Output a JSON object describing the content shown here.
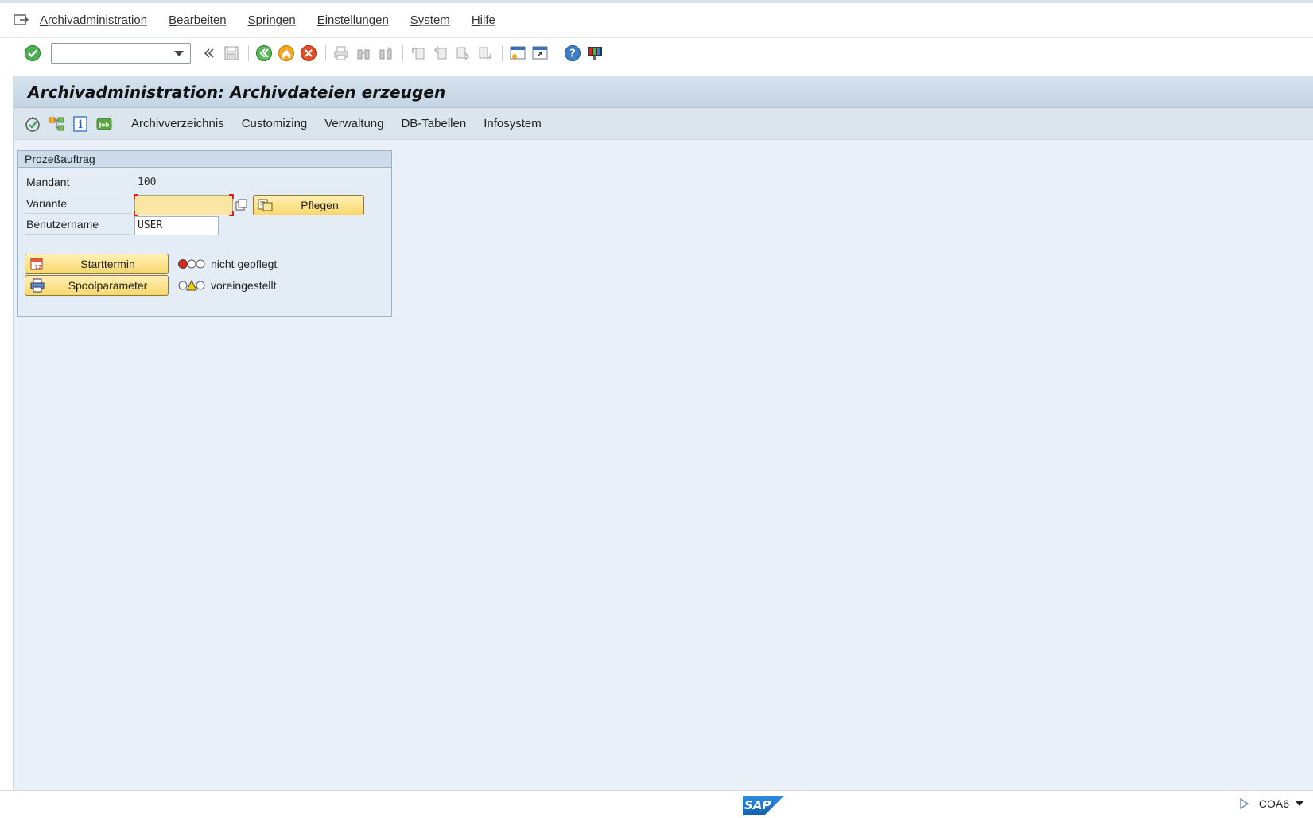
{
  "menubar": {
    "items": [
      "Archivadministration",
      "Bearbeiten",
      "Springen",
      "Einstellungen",
      "System",
      "Hilfe"
    ]
  },
  "toolbar": {
    "command_value": "",
    "icons": [
      "enter-icon",
      "back-double-icon",
      "save-icon",
      "back-icon",
      "exit-icon",
      "cancel-icon",
      "print-icon",
      "find-icon",
      "find-next-icon",
      "first-page-icon",
      "prev-page-icon",
      "next-page-icon",
      "last-page-icon",
      "new-session-icon",
      "shortcut-icon",
      "help-icon",
      "customize-layout-icon"
    ]
  },
  "title": "Archivadministration: Archivdateien erzeugen",
  "app_toolbar": {
    "links": [
      "Archivverzeichnis",
      "Customizing",
      "Verwaltung",
      "DB-Tabellen",
      "Infosystem"
    ]
  },
  "group": {
    "title": "Prozeßauftrag",
    "mandant_label": "Mandant",
    "mandant_value": "100",
    "variante_label": "Variante",
    "variante_value": "",
    "benutzer_label": "Benutzername",
    "benutzer_value": "USER",
    "pflegen_label": "Pflegen",
    "starttermin_label": "Starttermin",
    "starttermin_status": "nicht gepflegt",
    "spool_label": "Spoolparameter",
    "spool_status": "voreingestellt"
  },
  "statusbar": {
    "logo": "SAP",
    "transaction": "COA6"
  },
  "colors": {
    "screen_bg": "#e9f0f7",
    "button_yellow": "#f7d76d",
    "input_required": "#fbe7a3",
    "light_red": "#e2231a",
    "light_yellow": "#f5d000"
  }
}
